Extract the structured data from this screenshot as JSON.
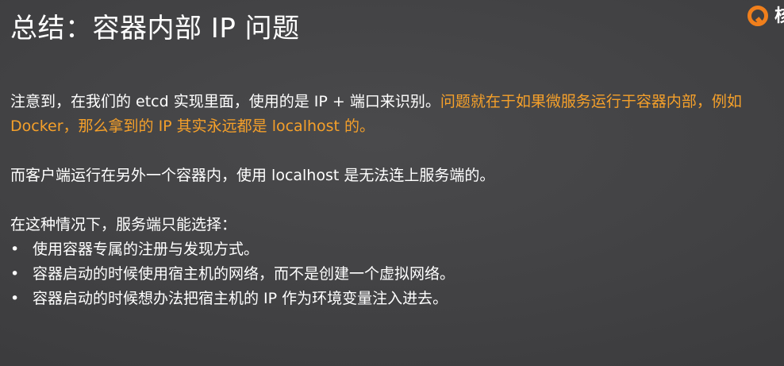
{
  "slide": {
    "title": "总结：容器内部 IP 问题",
    "logo": {
      "icon": "q-logo-icon",
      "brand_text": "核",
      "accent": "#f07f1c"
    },
    "paragraph1": {
      "normal": "注意到，在我们的 etcd 实现里面，使用的是 IP + 端口来识别。",
      "highlight": "问题就在于如果微服务运行于容器内部，例如 Docker，那么拿到的 IP 其实永远都是 localhost 的。"
    },
    "paragraph2": "而客户端运行在另外一个容器内，使用 localhost 是无法连上服务端的。",
    "paragraph3": "在这种情况下，服务端只能选择：",
    "bullet_glyph": "•",
    "bullets": [
      "使用容器专属的注册与发现方式。",
      "容器启动的时候使用宿主机的网络，而不是创建一个虚拟网络。",
      "容器启动的时候想办法把宿主机的 IP 作为环境变量注入进去。"
    ],
    "colors": {
      "background": "#424244",
      "text": "#ffffff",
      "highlight": "#f5a02a"
    }
  }
}
